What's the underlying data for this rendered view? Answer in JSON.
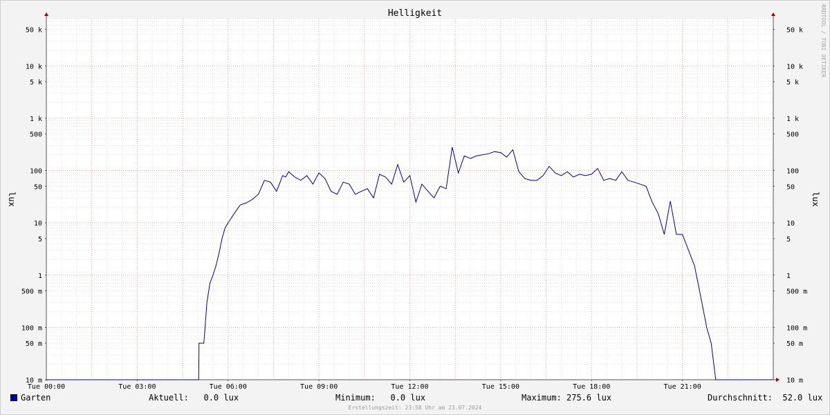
{
  "chart_data": {
    "type": "line",
    "title": "Helligkeit",
    "ylabel": "lux",
    "yscale": "log",
    "ylim": [
      0.01,
      80000
    ],
    "xlim_hours": [
      0,
      24
    ],
    "grid": true,
    "y_ticks": [
      {
        "value": 0.01,
        "label": "10 m"
      },
      {
        "value": 0.05,
        "label": "50 m"
      },
      {
        "value": 0.1,
        "label": "100 m"
      },
      {
        "value": 0.5,
        "label": "500 m"
      },
      {
        "value": 1,
        "label": "1"
      },
      {
        "value": 5,
        "label": "5"
      },
      {
        "value": 10,
        "label": "10"
      },
      {
        "value": 50,
        "label": "50"
      },
      {
        "value": 100,
        "label": "100"
      },
      {
        "value": 500,
        "label": "500"
      },
      {
        "value": 1000,
        "label": "1 k"
      },
      {
        "value": 5000,
        "label": "5 k"
      },
      {
        "value": 10000,
        "label": "10 k"
      },
      {
        "value": 50000,
        "label": "50 k"
      }
    ],
    "x_ticks": [
      {
        "hour": 0,
        "label": "Tue 00:00"
      },
      {
        "hour": 3,
        "label": "Tue 03:00"
      },
      {
        "hour": 6,
        "label": "Tue 06:00"
      },
      {
        "hour": 9,
        "label": "Tue 09:00"
      },
      {
        "hour": 12,
        "label": "Tue 12:00"
      },
      {
        "hour": 15,
        "label": "Tue 15:00"
      },
      {
        "hour": 18,
        "label": "Tue 18:00"
      },
      {
        "hour": 21,
        "label": "Tue 21:00"
      }
    ],
    "series": [
      {
        "name": "Garten",
        "color": "#0000a0",
        "x_hours": [
          0,
          5.03,
          5.04,
          5.2,
          5.24,
          5.3,
          5.4,
          5.5,
          5.6,
          5.7,
          5.8,
          5.9,
          6.0,
          6.2,
          6.4,
          6.6,
          6.8,
          7.0,
          7.2,
          7.4,
          7.6,
          7.8,
          7.9,
          8.0,
          8.2,
          8.4,
          8.6,
          8.8,
          9.0,
          9.2,
          9.4,
          9.6,
          9.8,
          10.0,
          10.2,
          10.4,
          10.6,
          10.8,
          11.0,
          11.2,
          11.4,
          11.6,
          11.8,
          12.0,
          12.2,
          12.4,
          12.6,
          12.8,
          13.0,
          13.2,
          13.4,
          13.6,
          13.8,
          14.0,
          14.2,
          14.4,
          14.6,
          14.8,
          15.0,
          15.2,
          15.4,
          15.6,
          15.8,
          16.0,
          16.2,
          16.4,
          16.6,
          16.8,
          17.0,
          17.2,
          17.4,
          17.6,
          17.8,
          18.0,
          18.2,
          18.4,
          18.6,
          18.8,
          19.0,
          19.2,
          19.4,
          19.6,
          19.8,
          20.0,
          20.2,
          20.4,
          20.6,
          20.8,
          21.0,
          21.2,
          21.4,
          21.6,
          21.8,
          21.95,
          22.1,
          24.0
        ],
        "values": [
          0.01,
          0.01,
          0.05,
          0.05,
          0.1,
          0.3,
          0.7,
          1,
          1.5,
          2.6,
          5,
          8,
          10,
          15,
          22,
          24,
          28,
          35,
          65,
          60,
          40,
          80,
          75,
          95,
          75,
          65,
          80,
          55,
          90,
          70,
          40,
          35,
          60,
          55,
          35,
          40,
          45,
          30,
          85,
          75,
          55,
          130,
          60,
          80,
          25,
          55,
          40,
          30,
          50,
          45,
          280,
          90,
          190,
          170,
          190,
          200,
          210,
          230,
          220,
          180,
          250,
          95,
          70,
          65,
          65,
          80,
          120,
          90,
          80,
          95,
          75,
          85,
          80,
          85,
          110,
          65,
          70,
          65,
          95,
          65,
          60,
          55,
          50,
          25,
          15,
          6,
          26,
          6,
          6,
          3,
          1.5,
          0.4,
          0.1,
          0.05,
          0.01,
          0.01
        ]
      }
    ]
  },
  "side_label": "RRDTOOL / TOBI OETIKER",
  "legend": {
    "series_name": "Garten",
    "current": "Aktuell:   0.0 lux",
    "minimum": "Minimum:   0.0 lux",
    "maximum": "Maximum: 275.6 lux",
    "average": "Durchschnitt:  52.0 lux"
  },
  "footer": "Erstellungszeit: 23:58 Uhr am 23.07.2024"
}
